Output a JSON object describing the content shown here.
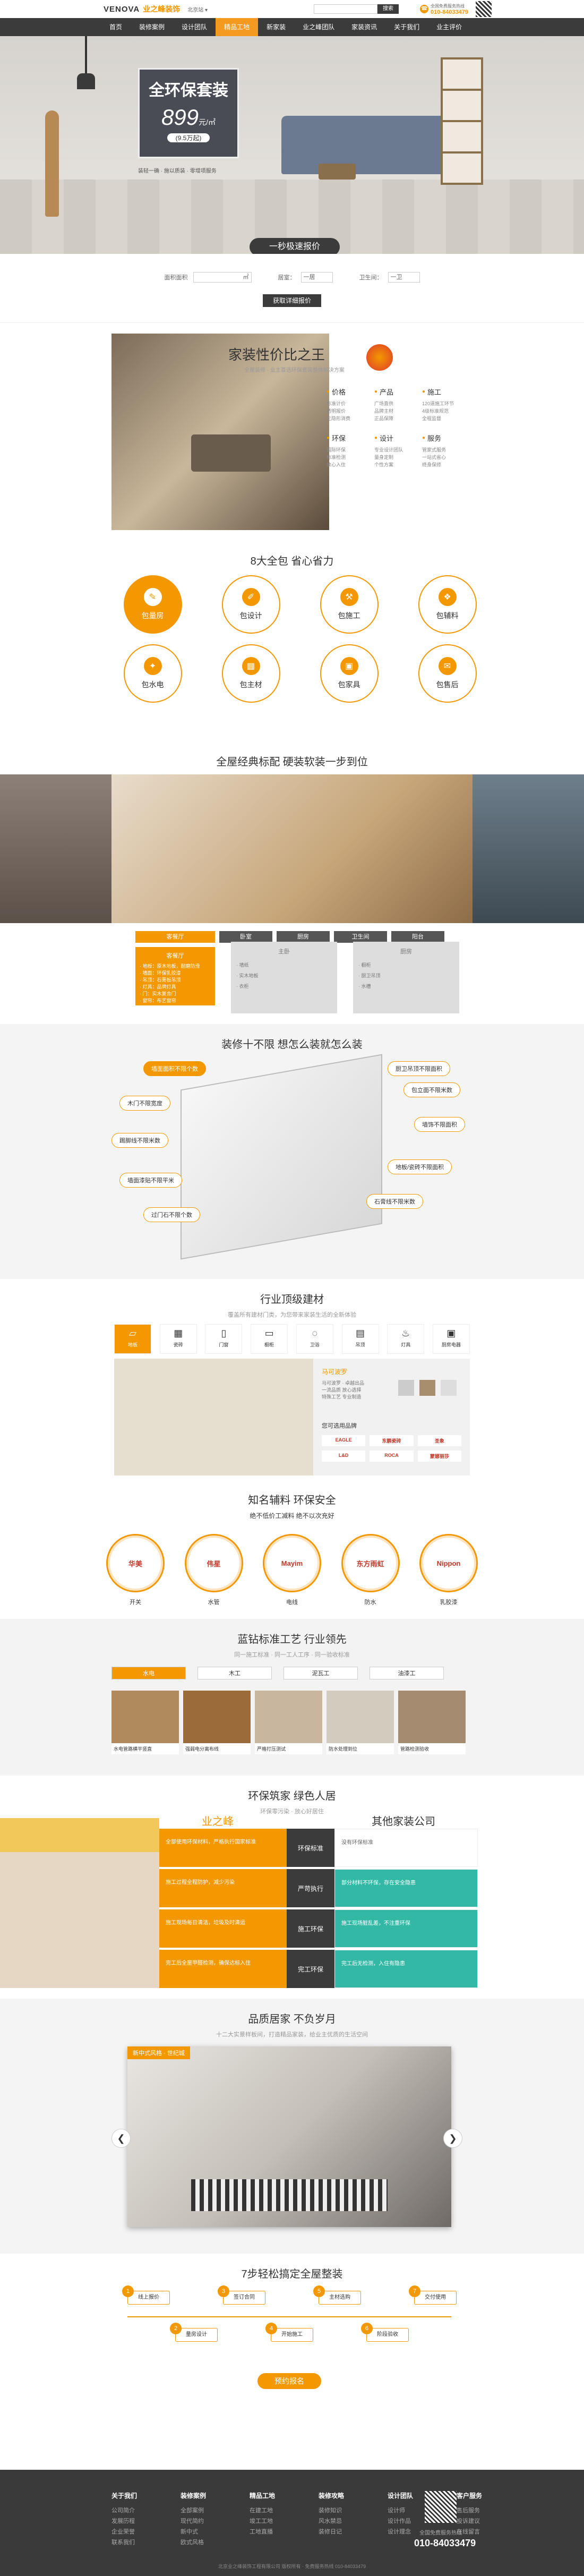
{
  "header": {
    "logo": "VENOVA",
    "logo_cn": "业之峰装饰",
    "city": "北京站 ▾",
    "search_btn": "搜索",
    "phone_label": "全国免费服务热线",
    "phone": "010-84033479"
  },
  "nav": [
    "首页",
    "装修案例",
    "设计团队",
    "精品工地",
    "新家装",
    "业之峰团队",
    "家装资讯",
    "关于我们",
    "业主评价"
  ],
  "nav_active": 3,
  "hero": {
    "badge": "全环保套装",
    "price": "899",
    "unit": "元/㎡",
    "sub": "(9.5万起)",
    "note1": "装轻一确 · 施以质装 · 零增项服务",
    "note2": "包含主料 · 辅料 · 施工 · 管理 · 设计"
  },
  "quote": {
    "btn": "一秒极速报价",
    "area_label": "面积面积",
    "area_unit": "㎡",
    "room_label": "居室：",
    "room_val": "一居",
    "bath_label": "卫生间：",
    "bath_val": "一卫",
    "submit": "获取详细报价"
  },
  "king": {
    "title": "家装性价比之王",
    "sub": "全屋装修 · 业主首选环保套装整体解决方案",
    "items": [
      {
        "t": "价格",
        "d": "标准计价\n透明报价\n无隐形消费"
      },
      {
        "t": "产品",
        "d": "广场直供\n品牌主材\n正品保障"
      },
      {
        "t": "施工",
        "d": "120道施工环节\n4级标准规范\n全程监督"
      },
      {
        "t": "环保",
        "d": "国际环保\n标准检测\n放心入住"
      },
      {
        "t": "设计",
        "d": "专业设计团队\n量身定制\n个性方案"
      },
      {
        "t": "服务",
        "d": "管家式服务\n一站式省心\n终身保修"
      }
    ]
  },
  "eight": {
    "title": "8大全包 省心省力",
    "items": [
      "包量房",
      "包设计",
      "包施工",
      "包辅料",
      "包水电",
      "包主材",
      "包家具",
      "包售后"
    ]
  },
  "std": {
    "title": "全屋经典标配 硬装软装一步到位",
    "tabs": [
      "客餐厅",
      "卧室",
      "厨房",
      "卫生间",
      "阳台"
    ],
    "card1_title": "客餐厅",
    "card1_items": [
      "地板：原木地板，耐磨防滑",
      "墙面：环保乳胶漆",
      "吊顶：石膏板吊顶",
      "灯具：品牌灯具",
      "门：实木复合门",
      "窗帘：布艺窗帘"
    ],
    "card2_title": "主卧",
    "card2_items": [
      "墙纸",
      "实木地板",
      "衣柜"
    ],
    "card3_title": "厨房",
    "card3_items": [
      "橱柜",
      "厨卫吊顶",
      "水槽"
    ]
  },
  "ten": {
    "title": "装修十不限 想怎么装就怎么装",
    "tags": [
      "墙面面积不限个数",
      "厨卫吊顶不限面积",
      "木门不限宽度",
      "包立面不限米数",
      "踢脚线不限米数",
      "墙饰不限面积",
      "墙面漆贴不限平米",
      "地板/瓷砖不限面积",
      "过门石不限个数",
      "石膏线不限米数"
    ]
  },
  "mat": {
    "title": "行业顶级建材",
    "sub": "覆盖所有建材门类，为您带来家装生活的全新体验",
    "icons": [
      "地板",
      "瓷砖",
      "门窗",
      "橱柜",
      "卫浴",
      "吊顶",
      "灯具",
      "厨房电器"
    ],
    "brand_label": "马可波罗",
    "brand_sub": "马可波罗 · 卓越出品\n一流品质 放心选择\n特殊工艺 专业制造",
    "brands_title": "您可选用品牌",
    "brands": [
      "EAGLE",
      "东鹏瓷砖",
      "圣象",
      "L&D",
      "ROCA",
      "蒙娜丽莎"
    ]
  },
  "aux": {
    "title": "知名辅料 环保安全",
    "sub": "绝不低价工减料 绝不以次充好",
    "items": [
      "开关",
      "水管",
      "电线",
      "防水",
      "乳胶漆"
    ],
    "logos": [
      "华美",
      "伟星",
      "Mayim",
      "东方雨虹",
      "Nippon"
    ]
  },
  "craft": {
    "title": "蓝钻标准工艺 行业领先",
    "sub": "同一施工标准 · 同一工人工序 · 同一验收标准",
    "tabs": [
      "水电",
      "木工",
      "泥瓦工",
      "油漆工"
    ],
    "caps": [
      "水电管路横平竖直",
      "强弱电分离布线",
      "严格打压测试",
      "防水处理到位",
      "管路检测验收"
    ]
  },
  "eco": {
    "title": "环保筑家 绿色人居",
    "sub": "环保零污染 · 放心好居住",
    "left": "业之峰",
    "right": "其他家装公司",
    "mid": [
      "环保标准",
      "严苛执行",
      "施工环保",
      "完工环保"
    ],
    "ldesc": [
      "全部使用环保材料，严格执行国家标准",
      "施工过程全程防护，减少污染",
      "施工现场每日清洁，垃圾及时清运",
      "完工后全屋甲醛检测，确保达标入住"
    ],
    "rdesc": [
      "没有环保标准",
      "部分材料不环保，存在安全隐患",
      "施工现场脏乱差，不注重环保",
      "完工后无检测，入住有隐患"
    ]
  },
  "case": {
    "title": "品质居家 不负岁月",
    "sub": "十二大实景样板间，打造精品家装，给业主优质的生活空间",
    "label": "新中式风格 · 世纪城"
  },
  "steps": {
    "title": "7步轻松搞定全屋整装",
    "items": [
      "线上报价",
      "量房设计",
      "签订合同",
      "开始施工",
      "主材选购",
      "阶段验收",
      "交付使用"
    ],
    "btn": "预约报名"
  },
  "footer": {
    "cols": [
      {
        "h": "关于我们",
        "li": [
          "公司简介",
          "发展历程",
          "企业荣誉",
          "联系我们"
        ]
      },
      {
        "h": "装修案例",
        "li": [
          "全部案例",
          "现代简约",
          "新中式",
          "欧式风格"
        ]
      },
      {
        "h": "精品工地",
        "li": [
          "在建工地",
          "竣工工地",
          "工地直播"
        ]
      },
      {
        "h": "装修攻略",
        "li": [
          "装修知识",
          "风水禁忌",
          "装修日记"
        ]
      },
      {
        "h": "设计团队",
        "li": [
          "设计师",
          "设计作品",
          "设计理念"
        ]
      },
      {
        "h": "客户服务",
        "li": [
          "售后服务",
          "投诉建议",
          "在线留言"
        ]
      }
    ],
    "phone_label": "全国免费服务热线",
    "phone": "010-84033479",
    "copy": "北京业之峰装饰工程有限公司 版权所有 · 免费服务热线 010-84033479"
  },
  "colors": {
    "accent": "#f39800",
    "dark": "#3b3b3b",
    "teal": "#33b8a6"
  }
}
